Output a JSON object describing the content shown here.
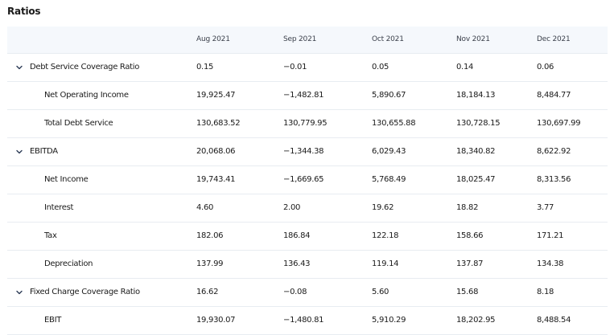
{
  "title": "Ratios",
  "columns": [
    "Aug 2021",
    "Sep 2021",
    "Oct 2021",
    "Nov 2021",
    "Dec 2021"
  ],
  "rows": [
    {
      "type": "group",
      "label": "Debt Service Coverage Ratio",
      "values": [
        "0.15",
        "−0.01",
        "0.05",
        "0.14",
        "0.06"
      ]
    },
    {
      "type": "child",
      "label": "Net Operating Income",
      "values": [
        "19,925.47",
        "−1,482.81",
        "5,890.67",
        "18,184.13",
        "8,484.77"
      ]
    },
    {
      "type": "child",
      "label": "Total Debt Service",
      "values": [
        "130,683.52",
        "130,779.95",
        "130,655.88",
        "130,728.15",
        "130,697.99"
      ]
    },
    {
      "type": "group",
      "label": "EBITDA",
      "values": [
        "20,068.06",
        "−1,344.38",
        "6,029.43",
        "18,340.82",
        "8,622.92"
      ]
    },
    {
      "type": "child",
      "label": "Net Income",
      "values": [
        "19,743.41",
        "−1,669.65",
        "5,768.49",
        "18,025.47",
        "8,313.56"
      ]
    },
    {
      "type": "child",
      "label": "Interest",
      "values": [
        "4.60",
        "2.00",
        "19.62",
        "18.82",
        "3.77"
      ]
    },
    {
      "type": "child",
      "label": "Tax",
      "values": [
        "182.06",
        "186.84",
        "122.18",
        "158.66",
        "171.21"
      ]
    },
    {
      "type": "child",
      "label": "Depreciation",
      "values": [
        "137.99",
        "136.43",
        "119.14",
        "137.87",
        "134.38"
      ]
    },
    {
      "type": "group",
      "label": "Fixed Charge Coverage Ratio",
      "values": [
        "16.62",
        "−0.08",
        "5.60",
        "15.68",
        "8.18"
      ]
    },
    {
      "type": "child",
      "label": "EBIT",
      "values": [
        "19,930.07",
        "−1,480.81",
        "5,910.29",
        "18,202.95",
        "8,488.54"
      ]
    }
  ]
}
